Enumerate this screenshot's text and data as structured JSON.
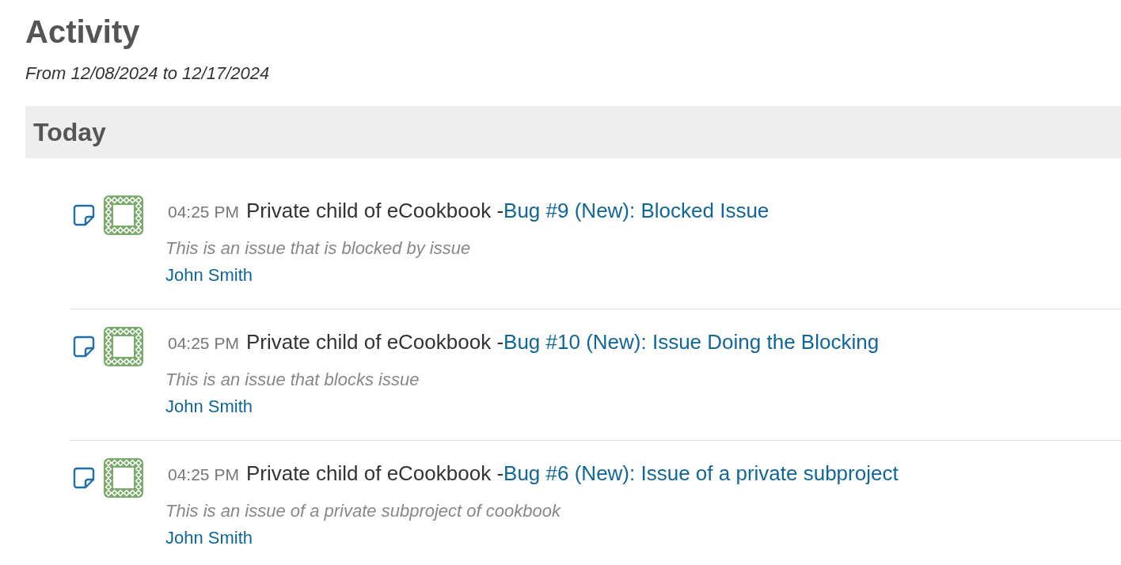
{
  "page": {
    "title": "Activity",
    "date_range": "From 12/08/2024 to 12/17/2024"
  },
  "groups": [
    {
      "heading": "Today",
      "events": [
        {
          "time": "04:25 PM",
          "project": "Private child of eCookbook -",
          "link": "Bug #9 (New): Blocked Issue",
          "description": "This is an issue that is blocked by issue",
          "author": "John Smith"
        },
        {
          "time": "04:25 PM",
          "project": "Private child of eCookbook -",
          "link": "Bug #10 (New): Issue Doing the Blocking",
          "description": "This is an issue that blocks issue",
          "author": "John Smith"
        },
        {
          "time": "04:25 PM",
          "project": "Private child of eCookbook -",
          "link": "Bug #6 (New): Issue of a private subproject",
          "description": "This is an issue of a private subproject of cookbook",
          "author": "John Smith"
        }
      ]
    }
  ]
}
